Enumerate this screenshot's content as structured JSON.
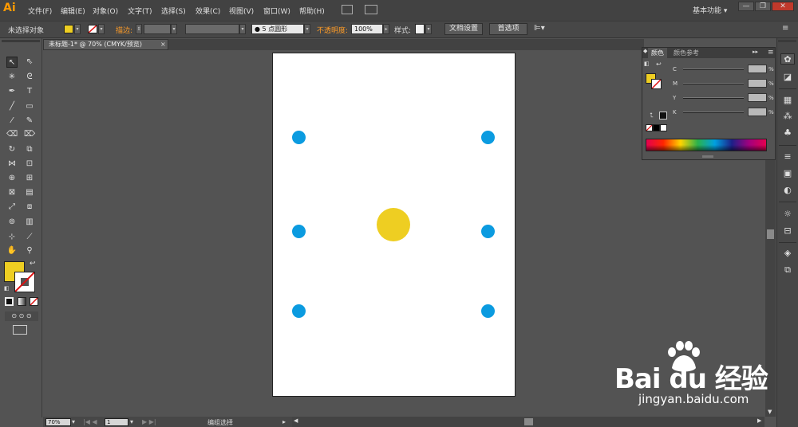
{
  "app": {
    "logo": "Ai",
    "workspace_label": "基本功能 ▾",
    "window_buttons": [
      "—",
      "❐",
      "✕"
    ]
  },
  "menu": {
    "items": [
      "文件(F)",
      "编辑(E)",
      "对象(O)",
      "文字(T)",
      "选择(S)",
      "效果(C)",
      "视图(V)",
      "窗口(W)",
      "帮助(H)"
    ]
  },
  "control_bar": {
    "selection_label": "未选择对象",
    "stroke_label": "描边:",
    "brush_label": "5 点圆形",
    "opacity_label": "不透明度:",
    "opacity_value": "100%",
    "style_label": "样式:",
    "doc_setup_button": "文档设置",
    "prefs_button": "首选项",
    "fill_color": "#eece22"
  },
  "document": {
    "tab_title": "未标题-1* @ 70% (CMYK/预览)",
    "tab_close": "×"
  },
  "artboard": {
    "blue_color": "#0b9be0",
    "yellow_color": "#eece22",
    "blue_dots": 6,
    "yellow_dots": 1
  },
  "color_panel": {
    "tabs": [
      "颜色",
      "颜色参考"
    ],
    "channels": [
      "C",
      "M",
      "Y",
      "K"
    ],
    "percent_sign": "%"
  },
  "status_bar": {
    "zoom": "70%",
    "page": "1",
    "status_text": "编组选择"
  },
  "watermark": {
    "brand": "Bai du 经验",
    "url": "jingyan.baidu.com"
  }
}
